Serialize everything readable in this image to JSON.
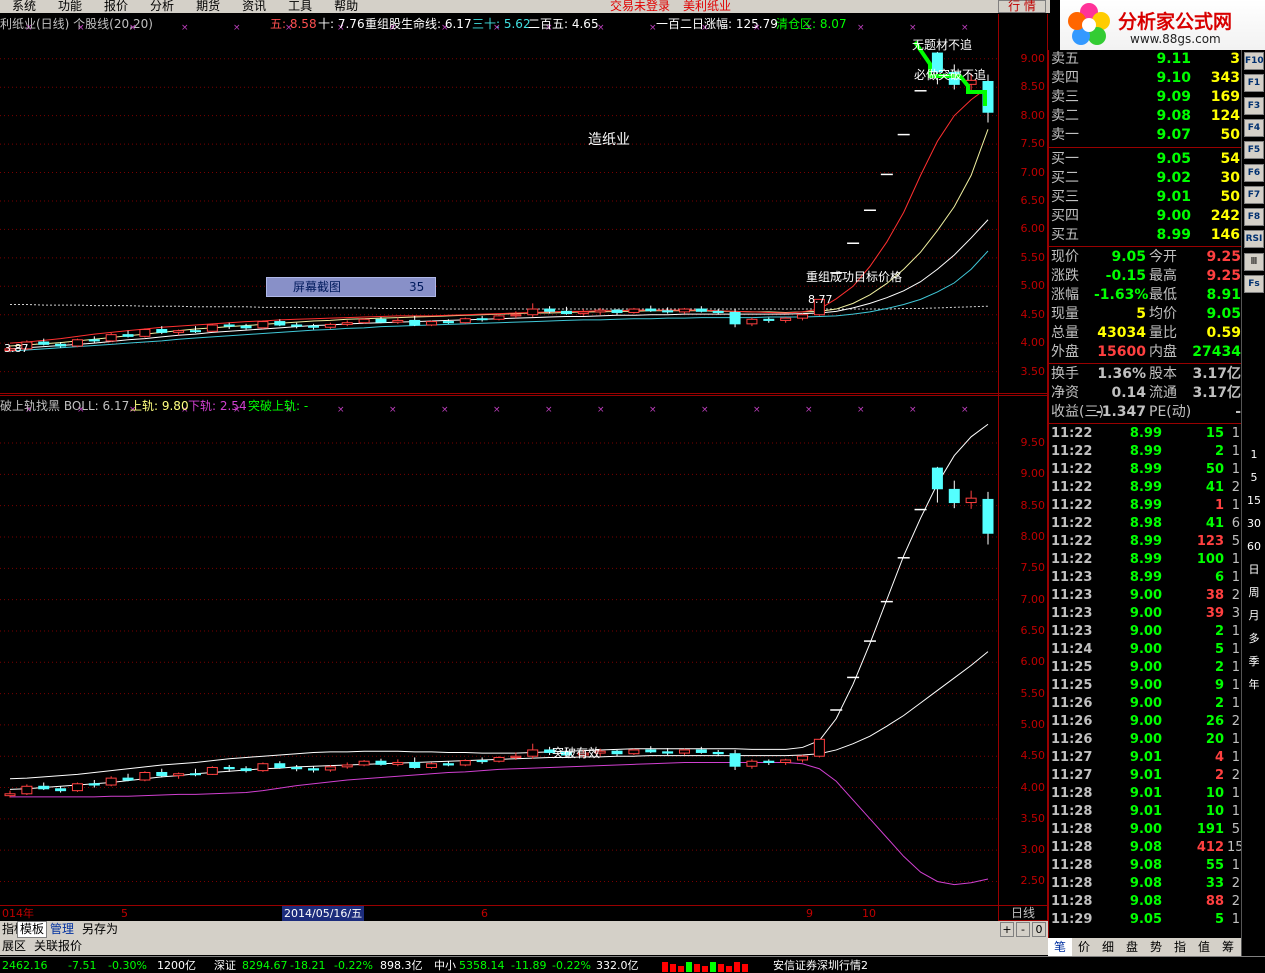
{
  "menu": {
    "items": [
      "系统",
      "功能",
      "报价",
      "分析",
      "期货",
      "资讯",
      "工具",
      "帮助"
    ],
    "login_status": "交易未登录",
    "stock_title": "美利纸业",
    "quote_button": "行 情"
  },
  "logo": {
    "title": "分析家公式网",
    "url": "www.88gs.com"
  },
  "top_pane": {
    "info": [
      {
        "text": "利纸业(日线) 个股线(20,20)",
        "color": "#c0c0c0"
      },
      {
        "text": "五: 8.58",
        "color": "#ff5050"
      },
      {
        "text": "十: 7.76",
        "color": "#ffffff"
      },
      {
        "text": "重组股生命线: 6.17",
        "color": "#ffffff"
      },
      {
        "text": "三十: 5.62",
        "color": "#40e0e0"
      },
      {
        "text": "二百五: 4.65",
        "color": "#ffffff"
      },
      {
        "text": "一百二日涨幅: 125.79",
        "color": "#ffffff"
      },
      {
        "text": "清仓区: 8.07",
        "color": "#00ff00"
      }
    ],
    "y_ticks": [
      "9.00",
      "8.50",
      "8.00",
      "7.50",
      "7.00",
      "6.50",
      "6.00",
      "5.50",
      "5.00",
      "4.50",
      "4.00",
      "3.50"
    ],
    "sector_label": "造纸业",
    "screenshot_box": {
      "label": "屏幕截图",
      "count": "35"
    },
    "target_label": "重组成功目标价格",
    "price_low_label": "3.87",
    "price_target_mark": "8.77",
    "top_labels": [
      "无题材不追",
      "必做",
      "突破不追"
    ]
  },
  "bottom_pane": {
    "info": [
      {
        "text": "破上轨找黑  BOLL: 6.17",
        "color": "#c0c0c0"
      },
      {
        "text": "上轨: 9.80",
        "color": "#ffff80"
      },
      {
        "text": "下轨: 2.54",
        "color": "#d040d0"
      },
      {
        "text": "突破上轨: -",
        "color": "#00ff00"
      }
    ],
    "y_ticks": [
      "9.50",
      "9.00",
      "8.50",
      "8.00",
      "7.50",
      "7.00",
      "6.50",
      "6.00",
      "5.50",
      "5.00",
      "4.50",
      "4.00",
      "3.50",
      "3.00",
      "2.50"
    ],
    "breakout_label": "突破有效"
  },
  "x_axis": {
    "labels": [
      "014年",
      "5",
      "2014/05/16/五",
      "6",
      "9",
      "10"
    ],
    "period": "日线"
  },
  "tabs": {
    "row1": [
      "指标",
      "模板",
      "管理",
      "另存为"
    ],
    "row2": [
      "展区",
      "关联报价"
    ],
    "controls": [
      "+",
      "-",
      "0"
    ]
  },
  "quote": {
    "sell": [
      {
        "label": "卖五",
        "price": "9.11",
        "vol": "3"
      },
      {
        "label": "卖四",
        "price": "9.10",
        "vol": "343"
      },
      {
        "label": "卖三",
        "price": "9.09",
        "vol": "169"
      },
      {
        "label": "卖二",
        "price": "9.08",
        "vol": "124"
      },
      {
        "label": "卖一",
        "price": "9.07",
        "vol": "50"
      }
    ],
    "buy": [
      {
        "label": "买一",
        "price": "9.05",
        "vol": "54"
      },
      {
        "label": "买二",
        "price": "9.02",
        "vol": "30"
      },
      {
        "label": "买三",
        "price": "9.01",
        "vol": "50"
      },
      {
        "label": "买四",
        "price": "9.00",
        "vol": "242"
      },
      {
        "label": "买五",
        "price": "8.99",
        "vol": "146"
      }
    ],
    "stats": [
      {
        "l1": "现价",
        "v1": "9.05",
        "c1": "#00ff00",
        "l2": "今开",
        "v2": "9.25",
        "c2": "#ff4040"
      },
      {
        "l1": "涨跌",
        "v1": "-0.15",
        "c1": "#00ff00",
        "l2": "最高",
        "v2": "9.25",
        "c2": "#ff4040"
      },
      {
        "l1": "涨幅",
        "v1": "-1.63%",
        "c1": "#00ff00",
        "l2": "最低",
        "v2": "8.91",
        "c2": "#00ff00"
      },
      {
        "l1": "现量",
        "v1": "5",
        "c1": "#ffff00",
        "l2": "均价",
        "v2": "9.05",
        "c2": "#00ff00"
      },
      {
        "l1": "总量",
        "v1": "43034",
        "c1": "#ffff00",
        "l2": "量比",
        "v2": "0.59",
        "c2": "#ffff00"
      },
      {
        "l1": "外盘",
        "v1": "15600",
        "c1": "#ff4040",
        "l2": "内盘",
        "v2": "27434",
        "c2": "#00ff00"
      }
    ],
    "stats2": [
      {
        "l1": "换手",
        "v1": "1.36%",
        "c1": "#c0c0c0",
        "l2": "股本",
        "v2": "3.17亿",
        "c2": "#c0c0c0"
      },
      {
        "l1": "净资",
        "v1": "0.14",
        "c1": "#c0c0c0",
        "l2": "流通",
        "v2": "3.17亿",
        "c2": "#c0c0c0"
      },
      {
        "l1": "收益(三)",
        "v1": "-1.347",
        "c1": "#c0c0c0",
        "l2": "PE(动)",
        "v2": "-",
        "c2": "#c0c0c0"
      }
    ],
    "ticks": [
      {
        "t": "11:22",
        "p": "8.99",
        "v": "15",
        "c": "g",
        "n": "1"
      },
      {
        "t": "11:22",
        "p": "8.99",
        "v": "2",
        "c": "g",
        "n": "1"
      },
      {
        "t": "11:22",
        "p": "8.99",
        "v": "50",
        "c": "g",
        "n": "1"
      },
      {
        "t": "11:22",
        "p": "8.99",
        "v": "41",
        "c": "g",
        "n": "2"
      },
      {
        "t": "11:22",
        "p": "8.99",
        "v": "1",
        "c": "r",
        "n": "1"
      },
      {
        "t": "11:22",
        "p": "8.98",
        "v": "41",
        "c": "g",
        "n": "6"
      },
      {
        "t": "11:22",
        "p": "8.99",
        "v": "123",
        "c": "r",
        "n": "5"
      },
      {
        "t": "11:22",
        "p": "8.99",
        "v": "100",
        "c": "g",
        "n": "1"
      },
      {
        "t": "11:23",
        "p": "8.99",
        "v": "6",
        "c": "g",
        "n": "1"
      },
      {
        "t": "11:23",
        "p": "9.00",
        "v": "38",
        "c": "r",
        "n": "2"
      },
      {
        "t": "11:23",
        "p": "9.00",
        "v": "39",
        "c": "r",
        "n": "3"
      },
      {
        "t": "11:23",
        "p": "9.00",
        "v": "2",
        "c": "g",
        "n": "1"
      },
      {
        "t": "11:24",
        "p": "9.00",
        "v": "5",
        "c": "g",
        "n": "1"
      },
      {
        "t": "11:25",
        "p": "9.00",
        "v": "2",
        "c": "g",
        "n": "1"
      },
      {
        "t": "11:25",
        "p": "9.00",
        "v": "9",
        "c": "g",
        "n": "1"
      },
      {
        "t": "11:26",
        "p": "9.00",
        "v": "2",
        "c": "g",
        "n": "1"
      },
      {
        "t": "11:26",
        "p": "9.00",
        "v": "26",
        "c": "g",
        "n": "2"
      },
      {
        "t": "11:26",
        "p": "9.00",
        "v": "20",
        "c": "g",
        "n": "1"
      },
      {
        "t": "11:27",
        "p": "9.01",
        "v": "4",
        "c": "r",
        "n": "1"
      },
      {
        "t": "11:27",
        "p": "9.01",
        "v": "2",
        "c": "r",
        "n": "2"
      },
      {
        "t": "11:28",
        "p": "9.01",
        "v": "10",
        "c": "g",
        "n": "1"
      },
      {
        "t": "11:28",
        "p": "9.01",
        "v": "10",
        "c": "g",
        "n": "1"
      },
      {
        "t": "11:28",
        "p": "9.00",
        "v": "191",
        "c": "g",
        "n": "5"
      },
      {
        "t": "11:28",
        "p": "9.08",
        "v": "412",
        "c": "r",
        "n": "15"
      },
      {
        "t": "11:28",
        "p": "9.08",
        "v": "55",
        "c": "g",
        "n": "1"
      },
      {
        "t": "11:28",
        "p": "9.08",
        "v": "33",
        "c": "g",
        "n": "2"
      },
      {
        "t": "11:28",
        "p": "9.08",
        "v": "88",
        "c": "r",
        "n": "2"
      },
      {
        "t": "11:29",
        "p": "9.05",
        "v": "5",
        "c": "g",
        "n": "1"
      }
    ],
    "tabs": [
      "笔",
      "价",
      "细",
      "盘",
      "势",
      "指",
      "值",
      "筹"
    ]
  },
  "sidebar": {
    "buttons": [
      "F10",
      "F1",
      "F3",
      "F4",
      "F5",
      "F6",
      "F7",
      "F8",
      "RSI",
      "Ⅲ",
      "Fs",
      "1",
      "5",
      "15",
      "30",
      "60",
      "日",
      "周",
      "月",
      "多",
      "季",
      "年"
    ]
  },
  "statusbar": {
    "items": [
      {
        "text": "2462.16",
        "color": "#00ff00"
      },
      {
        "text": "-7.51",
        "color": "#00ff00"
      },
      {
        "text": "-0.30%",
        "color": "#00ff00"
      },
      {
        "text": "1200亿",
        "color": "#ffffff"
      },
      {
        "text": "深证",
        "color": "#ffffff"
      },
      {
        "text": "8294.67",
        "color": "#00ff00"
      },
      {
        "text": "-18.21",
        "color": "#00ff00"
      },
      {
        "text": "-0.22%",
        "color": "#00ff00"
      },
      {
        "text": "898.3亿",
        "color": "#ffffff"
      },
      {
        "text": "中小",
        "color": "#ffffff"
      },
      {
        "text": "5358.14",
        "color": "#00ff00"
      },
      {
        "text": "-11.89",
        "color": "#00ff00"
      },
      {
        "text": "-0.22%",
        "color": "#00ff00"
      },
      {
        "text": "332.0亿",
        "color": "#ffffff"
      },
      {
        "text": "安信证券深圳行情2",
        "color": "#ffffff"
      }
    ]
  },
  "chart_data": {
    "type": "candlestick",
    "ylim_top": [
      3.3,
      9.4
    ],
    "ylim_bottom": [
      2.3,
      9.9
    ],
    "candles": [
      [
        3.87,
        3.95,
        3.84,
        3.9
      ],
      [
        3.9,
        4.05,
        3.88,
        4.02
      ],
      [
        4.02,
        4.08,
        3.96,
        3.98
      ],
      [
        3.98,
        4.02,
        3.92,
        3.95
      ],
      [
        3.95,
        4.08,
        3.93,
        4.06
      ],
      [
        4.06,
        4.12,
        4.0,
        4.04
      ],
      [
        4.04,
        4.18,
        4.02,
        4.15
      ],
      [
        4.15,
        4.22,
        4.1,
        4.12
      ],
      [
        4.12,
        4.26,
        4.1,
        4.24
      ],
      [
        4.24,
        4.3,
        4.16,
        4.19
      ],
      [
        4.19,
        4.24,
        4.14,
        4.22
      ],
      [
        4.22,
        4.3,
        4.18,
        4.21
      ],
      [
        4.21,
        4.34,
        4.2,
        4.32
      ],
      [
        4.32,
        4.36,
        4.25,
        4.3
      ],
      [
        4.3,
        4.34,
        4.24,
        4.27
      ],
      [
        4.27,
        4.4,
        4.25,
        4.38
      ],
      [
        4.38,
        4.42,
        4.3,
        4.32
      ],
      [
        4.32,
        4.36,
        4.26,
        4.3
      ],
      [
        4.3,
        4.34,
        4.24,
        4.28
      ],
      [
        4.28,
        4.36,
        4.25,
        4.33
      ],
      [
        4.33,
        4.4,
        4.3,
        4.36
      ],
      [
        4.36,
        4.44,
        4.34,
        4.42
      ],
      [
        4.42,
        4.46,
        4.35,
        4.37
      ],
      [
        4.37,
        4.45,
        4.34,
        4.4
      ],
      [
        4.4,
        4.48,
        4.3,
        4.32
      ],
      [
        4.32,
        4.4,
        4.3,
        4.38
      ],
      [
        4.38,
        4.42,
        4.34,
        4.36
      ],
      [
        4.36,
        4.45,
        4.34,
        4.43
      ],
      [
        4.43,
        4.48,
        4.38,
        4.42
      ],
      [
        4.42,
        4.5,
        4.4,
        4.48
      ],
      [
        4.48,
        4.56,
        4.44,
        4.5
      ],
      [
        4.5,
        4.7,
        4.46,
        4.6
      ],
      [
        4.6,
        4.65,
        4.52,
        4.56
      ],
      [
        4.56,
        4.64,
        4.5,
        4.52
      ],
      [
        4.52,
        4.6,
        4.48,
        4.55
      ],
      [
        4.55,
        4.62,
        4.5,
        4.58
      ],
      [
        4.58,
        4.6,
        4.5,
        4.54
      ],
      [
        4.54,
        4.62,
        4.52,
        4.6
      ],
      [
        4.6,
        4.66,
        4.55,
        4.57
      ],
      [
        4.57,
        4.63,
        4.52,
        4.55
      ],
      [
        4.55,
        4.62,
        4.52,
        4.6
      ],
      [
        4.6,
        4.65,
        4.54,
        4.56
      ],
      [
        4.56,
        4.6,
        4.5,
        4.54
      ],
      [
        4.54,
        4.6,
        4.28,
        4.34
      ],
      [
        4.34,
        4.45,
        4.3,
        4.42
      ],
      [
        4.42,
        4.45,
        4.36,
        4.4
      ],
      [
        4.4,
        4.46,
        4.36,
        4.44
      ],
      [
        4.44,
        4.52,
        4.4,
        4.5
      ],
      [
        4.5,
        4.77,
        4.48,
        4.77
      ],
      [
        5.25,
        5.25,
        5.25,
        5.25
      ],
      [
        5.77,
        5.77,
        5.77,
        5.77
      ],
      [
        6.35,
        6.35,
        6.35,
        6.35
      ],
      [
        6.98,
        6.98,
        6.98,
        6.98
      ],
      [
        7.68,
        7.68,
        7.68,
        7.68
      ],
      [
        8.45,
        8.45,
        8.45,
        8.45
      ],
      [
        9.1,
        9.12,
        8.55,
        8.77
      ],
      [
        8.76,
        8.9,
        8.46,
        8.55
      ],
      [
        8.55,
        8.74,
        8.45,
        8.62
      ],
      [
        8.6,
        8.72,
        7.88,
        8.06
      ]
    ],
    "ma5": [
      4.0,
      4.02,
      4.05,
      4.08,
      4.12,
      4.16,
      4.19,
      4.22,
      4.25,
      4.28,
      4.3,
      4.32,
      4.34,
      4.36,
      4.38,
      4.39,
      4.41,
      4.42,
      4.43,
      4.44,
      4.45,
      4.46,
      4.47,
      4.48,
      4.48,
      4.48,
      4.49,
      4.5,
      4.51,
      4.52,
      4.53,
      4.54,
      4.55,
      4.56,
      4.56,
      4.57,
      4.57,
      4.58,
      4.58,
      4.58,
      4.58,
      4.58,
      4.57,
      4.56,
      4.55,
      4.54,
      4.53,
      4.55,
      4.6,
      4.78,
      5.0,
      5.35,
      5.78,
      6.3,
      6.95,
      7.55,
      8.0,
      8.28,
      8.5
    ],
    "ma10": [
      3.95,
      3.97,
      3.99,
      4.01,
      4.04,
      4.07,
      4.1,
      4.13,
      4.16,
      4.19,
      4.22,
      4.25,
      4.27,
      4.29,
      4.31,
      4.33,
      4.35,
      4.37,
      4.39,
      4.4,
      4.42,
      4.43,
      4.44,
      4.45,
      4.46,
      4.47,
      4.48,
      4.49,
      4.5,
      4.51,
      4.52,
      4.53,
      4.53,
      4.54,
      4.55,
      4.55,
      4.56,
      4.56,
      4.57,
      4.57,
      4.57,
      4.57,
      4.56,
      4.56,
      4.55,
      4.55,
      4.54,
      4.55,
      4.56,
      4.6,
      4.7,
      4.85,
      5.05,
      5.3,
      5.6,
      5.98,
      6.4,
      6.95,
      7.76
    ],
    "ma20": [
      3.9,
      3.92,
      3.94,
      3.96,
      3.98,
      4.0,
      4.03,
      4.06,
      4.08,
      4.11,
      4.14,
      4.16,
      4.19,
      4.21,
      4.23,
      4.25,
      4.27,
      4.29,
      4.31,
      4.32,
      4.34,
      4.35,
      4.36,
      4.37,
      4.38,
      4.39,
      4.4,
      4.41,
      4.42,
      4.43,
      4.44,
      4.45,
      4.46,
      4.47,
      4.47,
      4.48,
      4.49,
      4.49,
      4.5,
      4.5,
      4.51,
      4.51,
      4.51,
      4.51,
      4.51,
      4.51,
      4.51,
      4.52,
      4.53,
      4.56,
      4.62,
      4.7,
      4.8,
      4.92,
      5.08,
      5.3,
      5.55,
      5.85,
      6.17
    ],
    "ma30": [
      3.86,
      3.88,
      3.9,
      3.92,
      3.94,
      3.96,
      3.98,
      4.0,
      4.02,
      4.04,
      4.07,
      4.09,
      4.11,
      4.13,
      4.15,
      4.17,
      4.19,
      4.21,
      4.23,
      4.24,
      4.26,
      4.27,
      4.29,
      4.3,
      4.31,
      4.32,
      4.33,
      4.34,
      4.35,
      4.36,
      4.37,
      4.38,
      4.39,
      4.4,
      4.41,
      4.41,
      4.42,
      4.43,
      4.43,
      4.44,
      4.44,
      4.45,
      4.45,
      4.45,
      4.45,
      4.46,
      4.46,
      4.46,
      4.47,
      4.48,
      4.51,
      4.55,
      4.61,
      4.68,
      4.77,
      4.9,
      5.06,
      5.3,
      5.62
    ],
    "ma250": [
      4.68,
      4.68,
      4.67,
      4.67,
      4.67,
      4.66,
      4.66,
      4.66,
      4.65,
      4.65,
      4.65,
      4.64,
      4.64,
      4.64,
      4.64,
      4.63,
      4.63,
      4.63,
      4.62,
      4.62,
      4.62,
      4.62,
      4.61,
      4.61,
      4.61,
      4.61,
      4.6,
      4.6,
      4.6,
      4.6,
      4.6,
      4.6,
      4.6,
      4.6,
      4.6,
      4.6,
      4.6,
      4.6,
      4.6,
      4.6,
      4.6,
      4.6,
      4.6,
      4.6,
      4.6,
      4.6,
      4.6,
      4.6,
      4.6,
      4.6,
      4.6,
      4.6,
      4.6,
      4.61,
      4.61,
      4.62,
      4.63,
      4.64,
      4.65
    ],
    "boll_upper": [
      4.14,
      4.15,
      4.17,
      4.19,
      4.21,
      4.24,
      4.27,
      4.3,
      4.33,
      4.36,
      4.38,
      4.4,
      4.43,
      4.46,
      4.48,
      4.5,
      4.52,
      4.54,
      4.56,
      4.57,
      4.57,
      4.58,
      4.58,
      4.58,
      4.57,
      4.57,
      4.56,
      4.56,
      4.55,
      4.55,
      4.55,
      4.56,
      4.57,
      4.58,
      4.59,
      4.6,
      4.61,
      4.62,
      4.62,
      4.62,
      4.62,
      4.62,
      4.62,
      4.62,
      4.61,
      4.61,
      4.61,
      4.64,
      4.75,
      5.1,
      5.65,
      6.3,
      7.0,
      7.7,
      8.3,
      8.85,
      9.3,
      9.6,
      9.8
    ],
    "boll_mid": [
      3.97,
      3.98,
      4.0,
      4.02,
      4.04,
      4.06,
      4.08,
      4.11,
      4.14,
      4.17,
      4.19,
      4.22,
      4.24,
      4.26,
      4.28,
      4.3,
      4.31,
      4.33,
      4.34,
      4.35,
      4.36,
      4.37,
      4.38,
      4.39,
      4.4,
      4.41,
      4.42,
      4.43,
      4.44,
      4.45,
      4.46,
      4.47,
      4.48,
      4.48,
      4.49,
      4.49,
      4.5,
      4.5,
      4.51,
      4.51,
      4.51,
      4.51,
      4.51,
      4.51,
      4.51,
      4.51,
      4.51,
      4.52,
      4.54,
      4.6,
      4.7,
      4.82,
      4.98,
      5.15,
      5.35,
      5.55,
      5.75,
      5.95,
      6.17
    ],
    "boll_lower": [
      3.85,
      3.85,
      3.85,
      3.85,
      3.85,
      3.85,
      3.86,
      3.86,
      3.87,
      3.88,
      3.89,
      3.89,
      3.9,
      3.91,
      3.92,
      3.95,
      3.99,
      4.03,
      4.06,
      4.09,
      4.12,
      4.14,
      4.16,
      4.18,
      4.2,
      4.22,
      4.24,
      4.25,
      4.27,
      4.29,
      4.3,
      4.31,
      4.32,
      4.33,
      4.34,
      4.35,
      4.36,
      4.37,
      4.38,
      4.39,
      4.4,
      4.4,
      4.4,
      4.4,
      4.4,
      4.4,
      4.4,
      4.38,
      4.3,
      4.1,
      3.8,
      3.5,
      3.2,
      2.9,
      2.65,
      2.5,
      2.45,
      2.48,
      2.54
    ]
  }
}
